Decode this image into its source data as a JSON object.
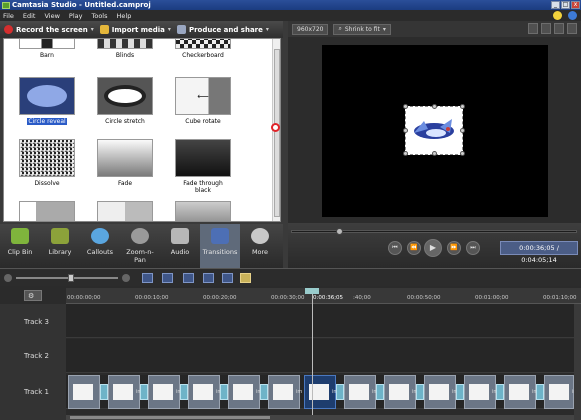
{
  "window": {
    "title": "Camtasia Studio - Untitled.camproj"
  },
  "menu": [
    "File",
    "Edit",
    "View",
    "Play",
    "Tools",
    "Help"
  ],
  "task_toolbar": {
    "record": "Record the screen",
    "import": "Import media",
    "produce": "Produce and share"
  },
  "transitions": [
    {
      "label": "Barn",
      "icon": "barn-transition-thumb"
    },
    {
      "label": "Blinds",
      "icon": "blinds-transition-thumb"
    },
    {
      "label": "Checkerboard",
      "icon": "checkerboard-transition-thumb"
    },
    {
      "label": "Circle reveal",
      "icon": "circle-reveal-thumb",
      "selected": true
    },
    {
      "label": "Circle stretch",
      "icon": "circle-stretch-thumb"
    },
    {
      "label": "Cube rotate",
      "icon": "cube-rotate-thumb"
    },
    {
      "label": "Dissolve",
      "icon": "dissolve-thumb"
    },
    {
      "label": "Fade",
      "icon": "fade-thumb"
    },
    {
      "label": "Fade through black",
      "icon": "fade-through-black-thumb"
    }
  ],
  "task_tabs": [
    {
      "label": "Clip Bin",
      "icon": "clip-bin-icon",
      "color": "#7fb43c"
    },
    {
      "label": "Library",
      "icon": "library-icon",
      "color": "#8ca23a"
    },
    {
      "label": "Callouts",
      "icon": "callouts-icon",
      "color": "#5aa6e0"
    },
    {
      "label": "Zoom-n-\nPan",
      "icon": "zoom-n-pan-icon",
      "color": "#9a9a9a"
    },
    {
      "label": "Audio",
      "icon": "audio-icon",
      "color": "#b7b7b7"
    },
    {
      "label": "Transitions",
      "icon": "transitions-icon",
      "color": "#4d6fb5",
      "active": true
    },
    {
      "label": "More",
      "icon": "more-icon",
      "color": "#c8c8c8"
    }
  ],
  "preview": {
    "resolution": "960x720",
    "fit": "Shrink to fit",
    "timecode": "0:00:36;05 / 0:04:05;14"
  },
  "timeline": {
    "ruler_labels": [
      "00:00:00;00",
      "00:00:10;00",
      "00:00:20;00",
      "00:00:30;00",
      "0:00:36;05",
      ":40;00",
      "00:00:50;00",
      "00:01:00;00",
      "00:01:10;00"
    ],
    "tracks": [
      "Track 3",
      "Track 2",
      "Track 1"
    ],
    "clip_labels": [
      "im",
      "im",
      "im",
      "im",
      "im",
      "im",
      "im",
      "im",
      "im",
      "im",
      "im",
      "im"
    ]
  },
  "colors": {
    "accent": "#2a5bc7",
    "timecode_bg": "#4b5d86"
  }
}
